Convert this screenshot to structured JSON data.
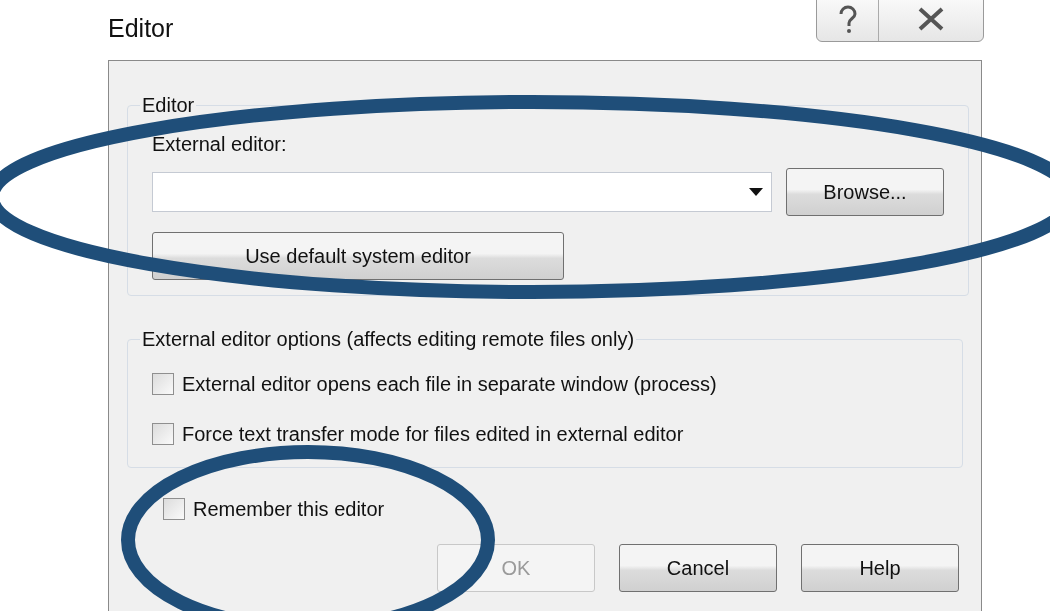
{
  "window": {
    "title": "Editor"
  },
  "editor_group": {
    "title": "Editor",
    "label": "External editor:",
    "browse_button": "Browse...",
    "default_button": "Use default system editor"
  },
  "options_group": {
    "title": "External editor options (affects editing remote files only)",
    "checkboxes": [
      {
        "label": "External editor opens each file in separate window (process)",
        "checked": false
      },
      {
        "label": "Force text transfer mode for files edited in external editor",
        "checked": false
      }
    ]
  },
  "remember": {
    "label": "Remember this editor",
    "checked": false
  },
  "buttons": [
    {
      "label": "OK",
      "disabled": true
    },
    {
      "label": "Cancel",
      "disabled": false
    },
    {
      "label": "Help",
      "disabled": false
    }
  ]
}
